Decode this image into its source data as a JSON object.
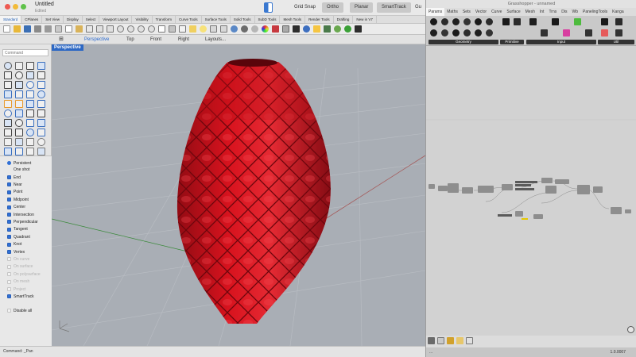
{
  "window": {
    "title": "Untitled",
    "subtitle": "Edited"
  },
  "modes": [
    {
      "label": "Grid Snap",
      "active": false
    },
    {
      "label": "Ortho",
      "active": true
    },
    {
      "label": "Planar",
      "active": true
    },
    {
      "label": "SmartTrack",
      "active": true
    },
    {
      "label": "Gu",
      "active": false
    }
  ],
  "toolbar_tabs": [
    "Standard",
    "CPlanes",
    "Set View",
    "Display",
    "Select",
    "Viewport Layout",
    "Visibility",
    "Transform",
    "Curve Tools",
    "Surface Tools",
    "Solid Tools",
    "SubD Tools",
    "Mesh Tools",
    "Render Tools",
    "Drafting",
    "New in V7"
  ],
  "view_tabs": [
    "Perspective",
    "Top",
    "Front",
    "Right",
    "Layouts..."
  ],
  "command": {
    "placeholder": "Command",
    "status": "Command: _Pan"
  },
  "viewport": {
    "label": "Perspective",
    "object_color": "#d0141e"
  },
  "osnap": {
    "persistent": "Persistent",
    "oneshot": "One shot",
    "items": [
      {
        "label": "End",
        "checked": true
      },
      {
        "label": "Near",
        "checked": true
      },
      {
        "label": "Point",
        "checked": true
      },
      {
        "label": "Midpoint",
        "checked": true
      },
      {
        "label": "Center",
        "checked": true
      },
      {
        "label": "Intersection",
        "checked": true
      },
      {
        "label": "Perpendicular",
        "checked": true
      },
      {
        "label": "Tangent",
        "checked": true
      },
      {
        "label": "Quadrant",
        "checked": true
      },
      {
        "label": "Knot",
        "checked": true
      },
      {
        "label": "Vertex",
        "checked": true
      },
      {
        "label": "On curve",
        "checked": false
      },
      {
        "label": "On surface",
        "checked": false
      },
      {
        "label": "On polysurface",
        "checked": false
      },
      {
        "label": "On mesh",
        "checked": false
      },
      {
        "label": "Project",
        "checked": false
      },
      {
        "label": "SmartTrack",
        "checked": true
      }
    ],
    "disable_all": "Disable all"
  },
  "grasshopper": {
    "title": "Grasshopper - unnamed",
    "tabs": [
      "Params",
      "Maths",
      "Sets",
      "Vector",
      "Curve",
      "Surface",
      "Mesh",
      "Int",
      "Trns",
      "Dis",
      "Wb",
      "PanelingTools",
      "Kanga"
    ],
    "groups": [
      "Geometry",
      "Primitive",
      "Input",
      "Util"
    ],
    "version": "1.0.0007",
    "status_left": "..."
  }
}
